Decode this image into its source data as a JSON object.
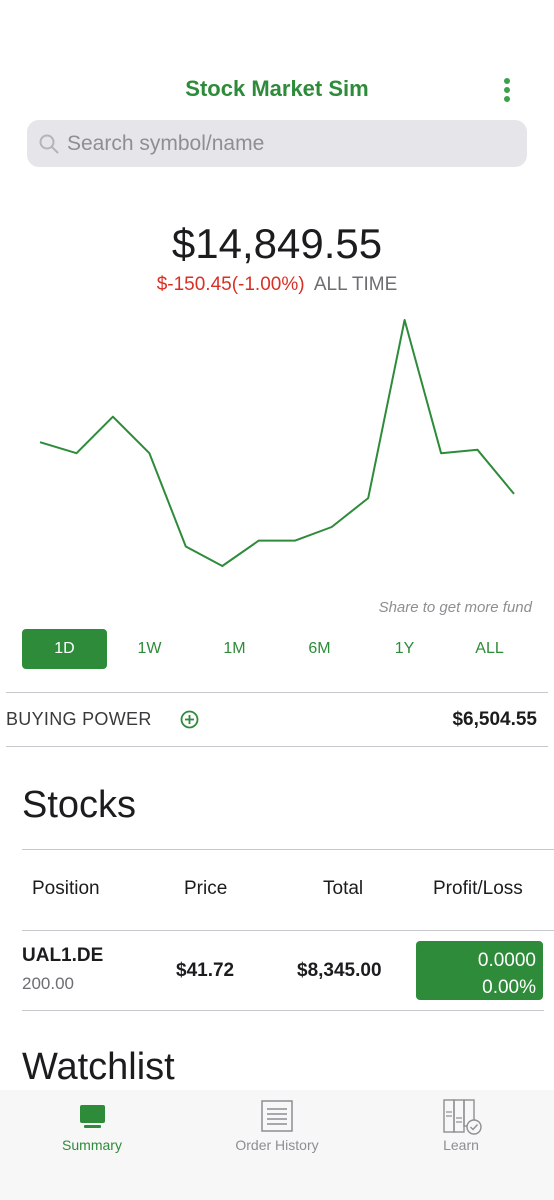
{
  "header": {
    "title": "Stock Market Sim"
  },
  "search": {
    "placeholder": "Search symbol/name"
  },
  "portfolio": {
    "balance": "$14,849.55",
    "change": "$-150.45(-1.00%)",
    "change_period": "ALL TIME",
    "share_note": "Share to get more fund"
  },
  "chart_data": {
    "type": "line",
    "title": "",
    "xlabel": "",
    "ylabel": "",
    "grid": false,
    "color": "#2e8b3a",
    "values": [
      14.6,
      13.3,
      17.6,
      13.3,
      2.3,
      0.0,
      3.0,
      3.0,
      4.6,
      8.0,
      29.0,
      13.3,
      13.7,
      8.5
    ]
  },
  "range_tabs": {
    "items": [
      "1D",
      "1W",
      "1M",
      "6M",
      "1Y",
      "ALL"
    ],
    "active": "1D"
  },
  "buying_power": {
    "label": "BUYING POWER",
    "value": "$6,504.55"
  },
  "stocks": {
    "title": "Stocks",
    "columns": [
      "Position",
      "Price",
      "Total",
      "Profit/Loss"
    ],
    "rows": [
      {
        "symbol": "UAL1.DE",
        "shares": "200.00",
        "price": "$41.72",
        "total": "$8,345.00",
        "pl_value": "0.0000",
        "pl_percent": "0.00%"
      }
    ]
  },
  "watchlist": {
    "title": "Watchlist"
  },
  "tabbar": {
    "items": [
      {
        "label": "Summary",
        "icon": "monitor-icon"
      },
      {
        "label": "Order History",
        "icon": "list-icon"
      },
      {
        "label": "Learn",
        "icon": "books-icon"
      }
    ],
    "active": "Summary"
  },
  "colors": {
    "accent": "#2e8b3a",
    "negative": "#d93025"
  }
}
